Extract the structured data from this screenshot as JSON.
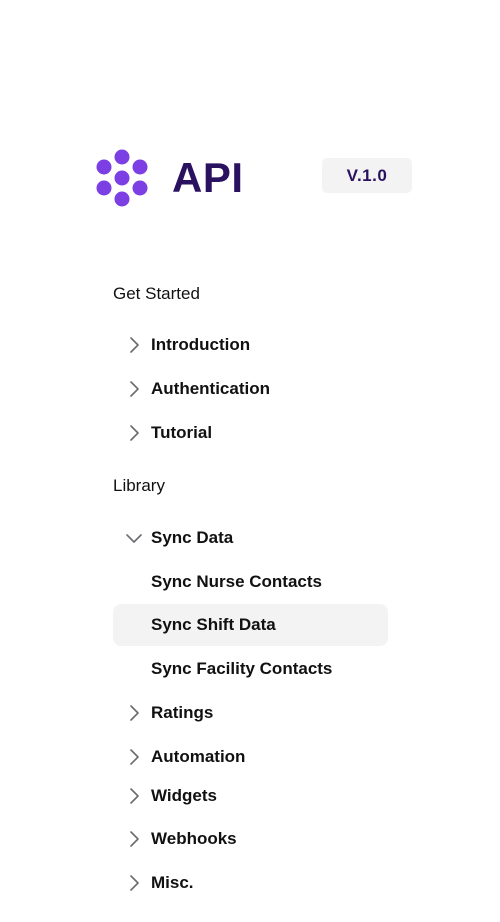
{
  "brand": {
    "name": "API",
    "version": "V.1.0",
    "logo_color": "#7b3fe4",
    "text_color": "#2a1260"
  },
  "nav": {
    "get_started": {
      "label": "Get Started",
      "items": [
        {
          "label": "Introduction",
          "icon": "chevron-right-icon"
        },
        {
          "label": "Authentication",
          "icon": "chevron-right-icon"
        },
        {
          "label": "Tutorial",
          "icon": "chevron-right-icon"
        }
      ]
    },
    "library": {
      "label": "Library",
      "items": [
        {
          "label": "Sync Data",
          "icon": "chevron-down-icon",
          "expanded": true
        },
        {
          "label": "Sync Nurse Contacts"
        },
        {
          "label": "Sync Shift Data",
          "active": true
        },
        {
          "label": "Sync Facility Contacts"
        },
        {
          "label": "Ratings",
          "icon": "chevron-right-icon"
        },
        {
          "label": "Automation",
          "icon": "chevron-right-icon"
        },
        {
          "label": "Widgets",
          "icon": "chevron-right-icon"
        },
        {
          "label": "Webhooks",
          "icon": "chevron-right-icon"
        },
        {
          "label": "Misc.",
          "icon": "chevron-right-icon"
        }
      ]
    }
  },
  "colors": {
    "active_bg": "#f3f3f4",
    "chevron": "#6b6b70"
  }
}
